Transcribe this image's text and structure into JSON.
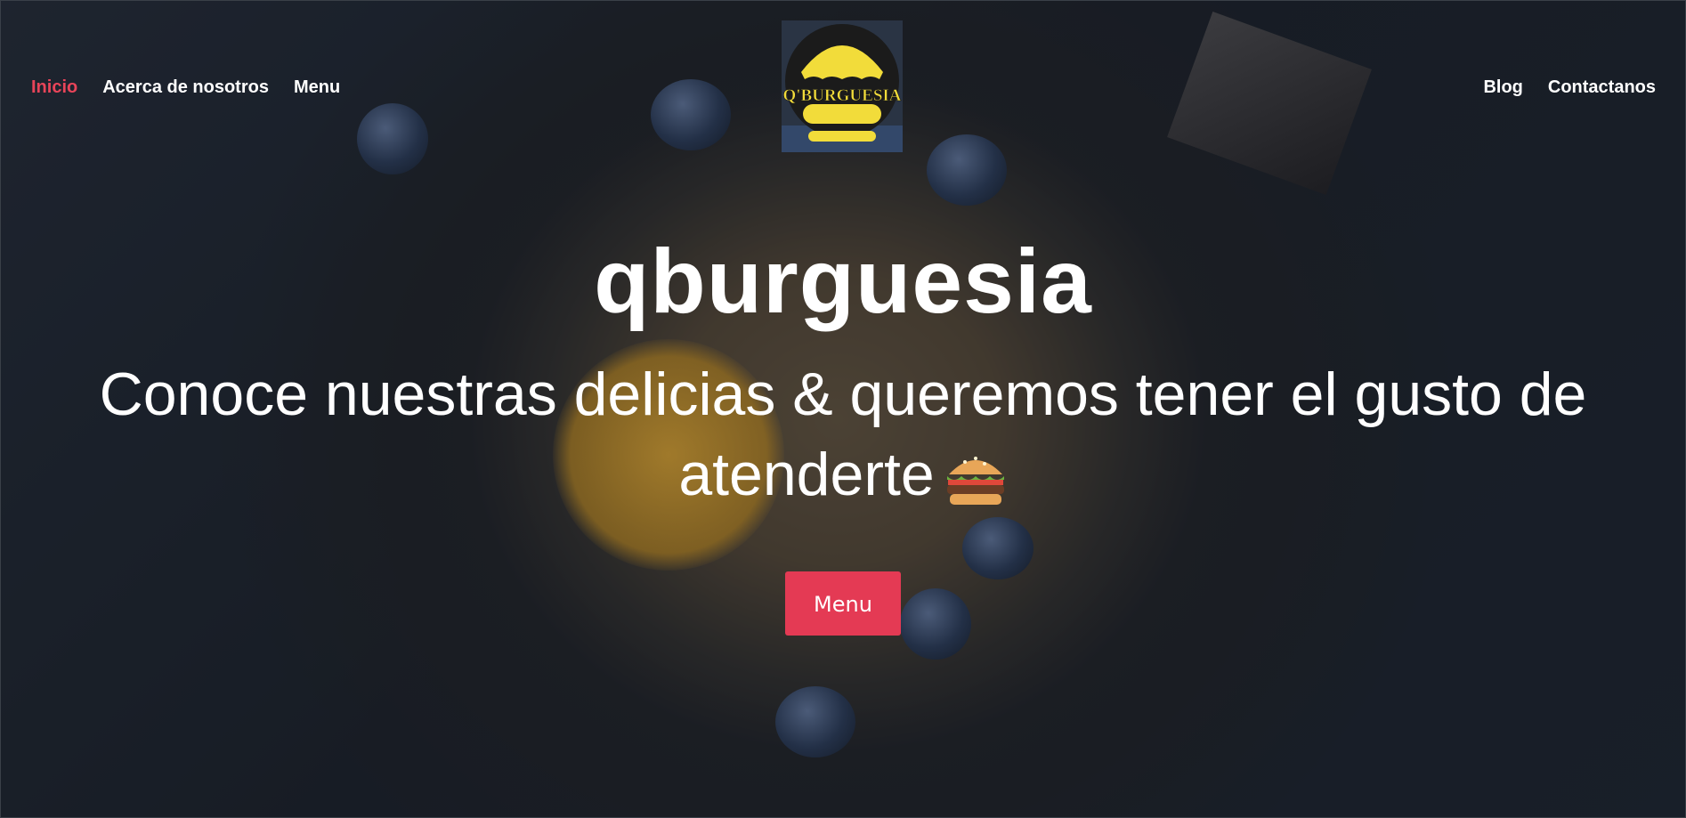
{
  "nav": {
    "left": [
      {
        "label": "Inicio",
        "active": true
      },
      {
        "label": "Acerca de nosotros",
        "active": false
      },
      {
        "label": "Menu",
        "active": false
      }
    ],
    "right": [
      {
        "label": "Blog"
      },
      {
        "label": "Contactanos"
      }
    ]
  },
  "logo": {
    "text": "Q'BURGUESIA",
    "icon": "burger-logo-icon"
  },
  "hero": {
    "title": "qburguesia",
    "subtitle": "Conoce nuestras delicias & queremos tener el gusto de atenderte",
    "subtitle_icon": "hamburger-emoji-icon",
    "button_label": "Menu"
  },
  "colors": {
    "accent": "#e43a54",
    "active_nav": "#e84459",
    "logo_yellow": "#f2dc3a"
  }
}
